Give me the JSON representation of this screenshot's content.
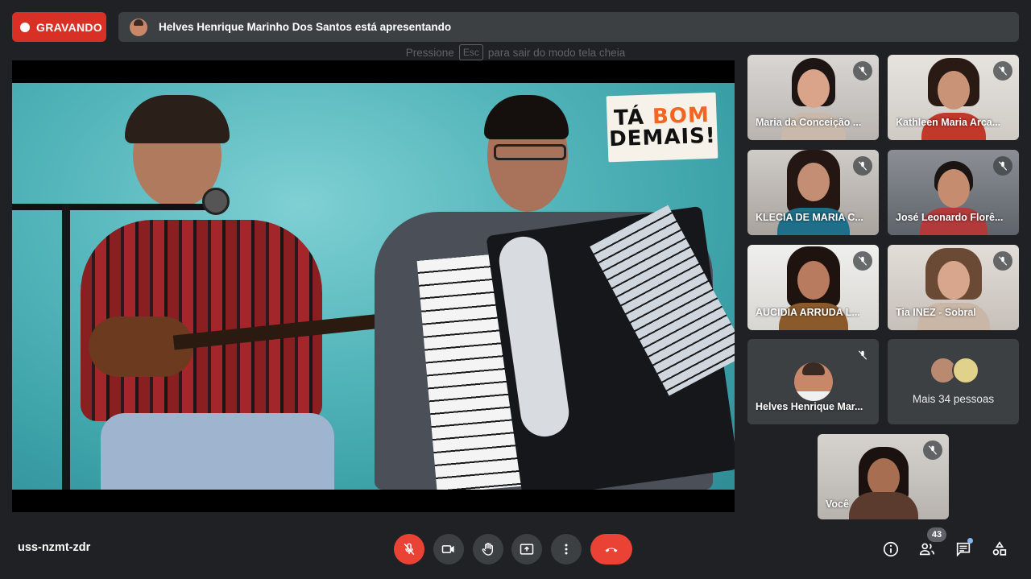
{
  "recording": {
    "label": "GRAVANDO"
  },
  "presenter_bar": {
    "text": "Helves Henrique Marinho Dos Santos está apresentando"
  },
  "fullscreen_hint": {
    "prefix": "Pressione",
    "key": "Esc",
    "suffix": "para sair do modo tela cheia"
  },
  "presentation": {
    "watermark_line1_a": "TÁ",
    "watermark_line1_b": "BOM",
    "watermark_line2": "DEMAIS!"
  },
  "participants": [
    {
      "name": "Maria da Conceição ..."
    },
    {
      "name": "Kathleen Maria Arca..."
    },
    {
      "name": "KLECIA DE MARIA C..."
    },
    {
      "name": "José Leonardo Florê..."
    },
    {
      "name": "AUCIDIA ARRUDA L..."
    },
    {
      "name": "Tia INEZ - Sobral"
    },
    {
      "name": "Helves Henrique Mar..."
    },
    {
      "more_label": "Mais 34 pessoas"
    },
    {
      "name": "Você"
    }
  ],
  "meeting": {
    "code": "uss-nzmt-zdr",
    "people_count": "43"
  },
  "colors": {
    "danger": "#ea4335",
    "surface": "#3c4043",
    "background": "#202124",
    "accent": "#8ab4f8"
  },
  "icons": {
    "mic": "mic-off-icon",
    "camera": "camera-icon",
    "hand": "raise-hand-icon",
    "present": "present-icon",
    "more": "more-vert-icon",
    "hangup": "hangup-icon",
    "info": "info-icon",
    "people": "people-icon",
    "chat": "chat-icon",
    "activities": "activities-icon"
  }
}
